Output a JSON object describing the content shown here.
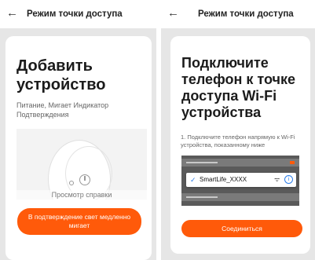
{
  "left_screen": {
    "back_icon": "arrow-left-icon",
    "back_glyph": "←",
    "title": "Режим точки доступа",
    "heading": "Добавить устройство",
    "description": "Питание, Мигает Индикатор Подтверждения",
    "help_link": "Просмотр справки",
    "confirm_button": "В подтверждение свет медленно мигает"
  },
  "right_screen": {
    "back_icon": "arrow-left-icon",
    "back_glyph": "←",
    "title": "Режим точки доступа",
    "heading": "Подключите телефон к точке доступа Wi-Fi устройства",
    "instruction": "1. Подключите телефон напрямую к Wi-Fi устройства, показанному ниже",
    "wifi_check": "✓",
    "wifi_ssid": "SmartLife_XXXX",
    "wifi_icon_glyph": "ᯤ",
    "info_icon_glyph": "i",
    "connect_button": "Соединиться"
  },
  "colors": {
    "accent": "#ff5a0a",
    "background": "#e6e6e6",
    "link_blue": "#2b7de9"
  }
}
